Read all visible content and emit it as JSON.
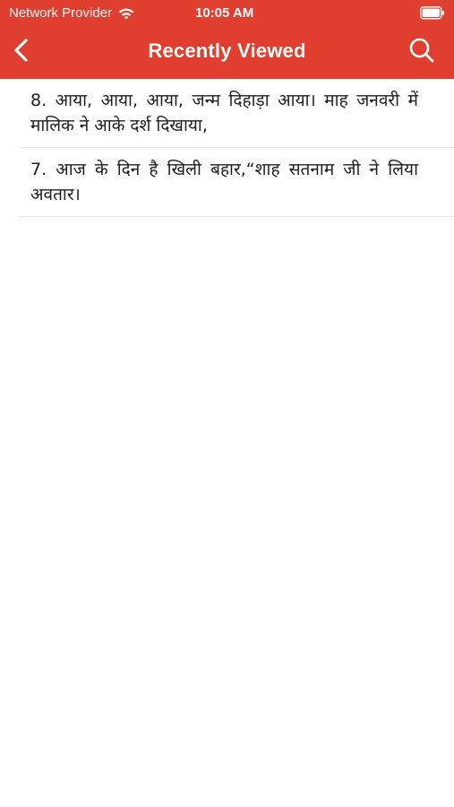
{
  "status_bar": {
    "carrier": "Network Provider",
    "time": "10:05 AM",
    "wifi_icon": "wifi-icon",
    "battery_icon": "battery-icon"
  },
  "nav": {
    "title": "Recently Viewed",
    "back_icon": "chevron-left-icon",
    "search_icon": "search-icon",
    "background_color": "#e03f2f"
  },
  "recent_items": [
    {
      "text": "8. आया, आया, आया,  जन्म  दिहाड़ा आया।  माह जनवरी में मालिक ने आके दर्श दिखाया,"
    },
    {
      "text": "7. आज  के  दिन  है खिली  बहार,“शाह सतनाम जी ने लिया अवतार।"
    }
  ]
}
